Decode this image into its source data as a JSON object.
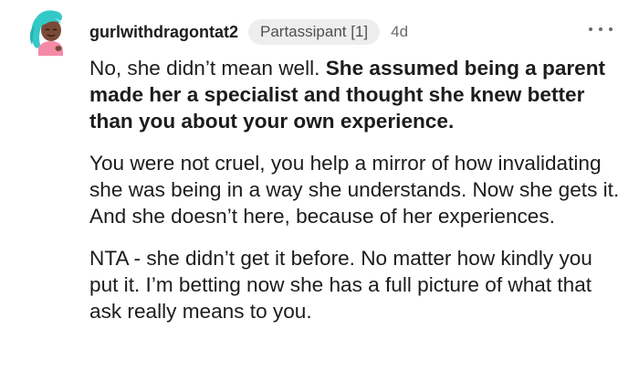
{
  "comment": {
    "username": "gurlwithdragontat2",
    "flair": "Partassipant [1]",
    "timestamp": "4d",
    "more_icon": "more-horizontal-icon",
    "avatar_icon": "snoo-avatar",
    "colors": {
      "avatar_hair": "#33c9c9",
      "avatar_skin": "#7a4a38",
      "avatar_shirt": "#f58aa8",
      "avatar_background": "#ffffff"
    },
    "paragraphs": [
      {
        "plain": "No, she didn’t mean well. ",
        "bold": "She assumed being a parent made her a specialist and thought she knew better than you about your own experience."
      },
      {
        "text": "You were not cruel, you help a mirror of how invalidating she was being in a way she understands. Now she gets it. And she doesn’t here, because of her experiences."
      },
      {
        "text": "NTA - she didn’t get it before. No matter how kindly you put it. I’m betting now she has a full picture of what that ask really means to you."
      }
    ]
  }
}
